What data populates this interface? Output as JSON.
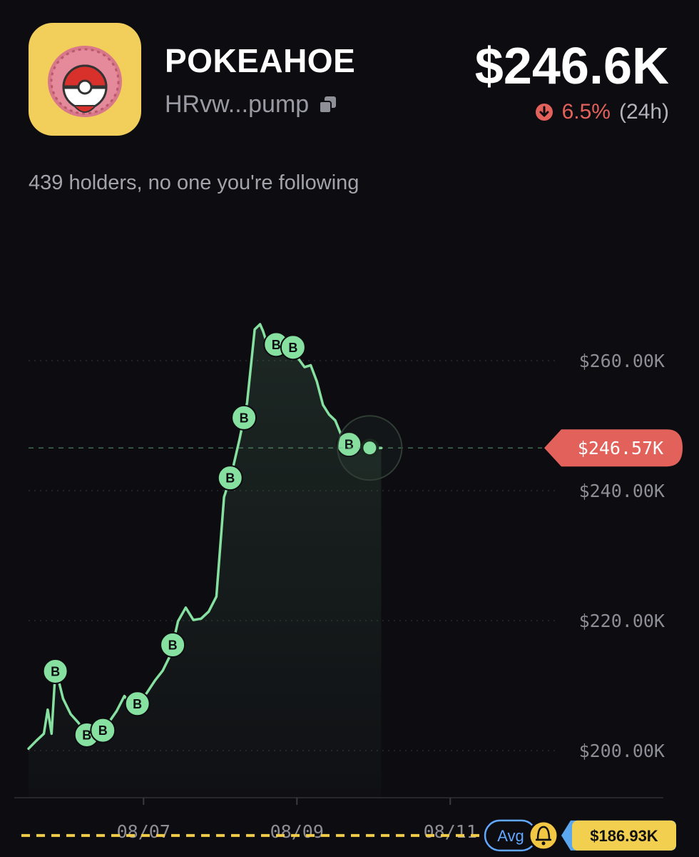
{
  "token": {
    "name": "POKEAHOE",
    "address_short": "HRvw...pump",
    "logo_icon": "pokeball-fur-hood-logo",
    "copy_icon": "copy-icon"
  },
  "market_cap": {
    "value": "$246.6K",
    "change_pct": "6.5%",
    "change_period": "(24h)",
    "direction": "down",
    "down_color": "#e2625b"
  },
  "holders_text": "439 holders, no one you're following",
  "chart_data": {
    "type": "line",
    "y_ticks": [
      "$200.00K",
      "$220.00K",
      "$240.00K",
      "$260.00K"
    ],
    "x_ticks": [
      "08/07",
      "08/09",
      "08/11"
    ],
    "ylim": [
      186000,
      270000
    ],
    "grid": true,
    "line_color": "#86e0a0",
    "current_price": 246570,
    "current_price_label": "$246.57K",
    "avg_label": "Avg",
    "avg_price": 186930,
    "avg_price_label": "$186.93K",
    "buy_marker_label": "B",
    "series": [
      {
        "x": [
          0.0,
          0.1,
          0.2,
          0.25,
          0.3,
          0.35,
          0.38,
          0.45,
          0.55,
          0.65,
          0.75,
          0.85,
          0.95,
          1.05,
          1.15,
          1.25,
          1.35,
          1.45,
          1.55,
          1.65,
          1.75,
          1.85,
          1.95,
          2.05,
          2.15,
          2.25,
          2.35,
          2.45,
          2.55,
          2.65,
          2.75,
          2.85,
          2.95,
          3.02,
          3.06,
          3.1,
          3.15,
          3.2,
          3.28,
          3.36,
          3.44,
          3.52,
          3.6,
          3.68,
          3.76,
          3.84,
          3.92,
          4.0,
          4.08,
          4.16,
          4.24,
          4.3,
          4.45,
          4.6
        ],
        "values": [
          200300,
          201500,
          202600,
          206300,
          202600,
          212200,
          211400,
          208000,
          205600,
          204300,
          202500,
          201700,
          202800,
          204400,
          206100,
          208400,
          206800,
          207400,
          209000,
          210800,
          212300,
          214700,
          219900,
          222000,
          220100,
          220300,
          221400,
          223700,
          239000,
          242700,
          247800,
          253500,
          264800,
          265600,
          264500,
          263000,
          262300,
          263200,
          261300,
          262500,
          262300,
          260300,
          259000,
          259300,
          256800,
          253200,
          251700,
          250800,
          248500,
          247200,
          246900,
          246570,
          246570,
          246570
        ]
      }
    ],
    "buy_markers_x": [
      0.35,
      0.76,
      0.97,
      1.42,
      1.88,
      2.63,
      2.81,
      3.23,
      3.45,
      4.18
    ]
  }
}
